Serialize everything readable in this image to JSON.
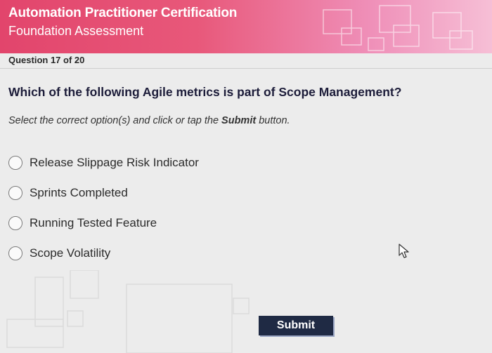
{
  "header": {
    "title": "Automation Practitioner Certification",
    "subtitle": "Foundation Assessment"
  },
  "question": {
    "counter": "Question 17 of 20",
    "text": "Which of the following Agile metrics is part of Scope Management?",
    "instruction_prefix": "Select the correct option(s) and click or tap the ",
    "instruction_bold": "Submit",
    "instruction_suffix": " button."
  },
  "options": [
    {
      "label": "Release Slippage Risk Indicator"
    },
    {
      "label": "Sprints Completed"
    },
    {
      "label": "Running Tested Feature"
    },
    {
      "label": "Scope Volatility"
    }
  ],
  "submit_label": "Submit",
  "colors": {
    "header_start": "#e2456c",
    "header_end": "#f6bfd6",
    "submit_bg": "#1f2a44"
  },
  "icons": [
    "mouse-pointer-icon",
    "radio-unchecked-icon"
  ]
}
